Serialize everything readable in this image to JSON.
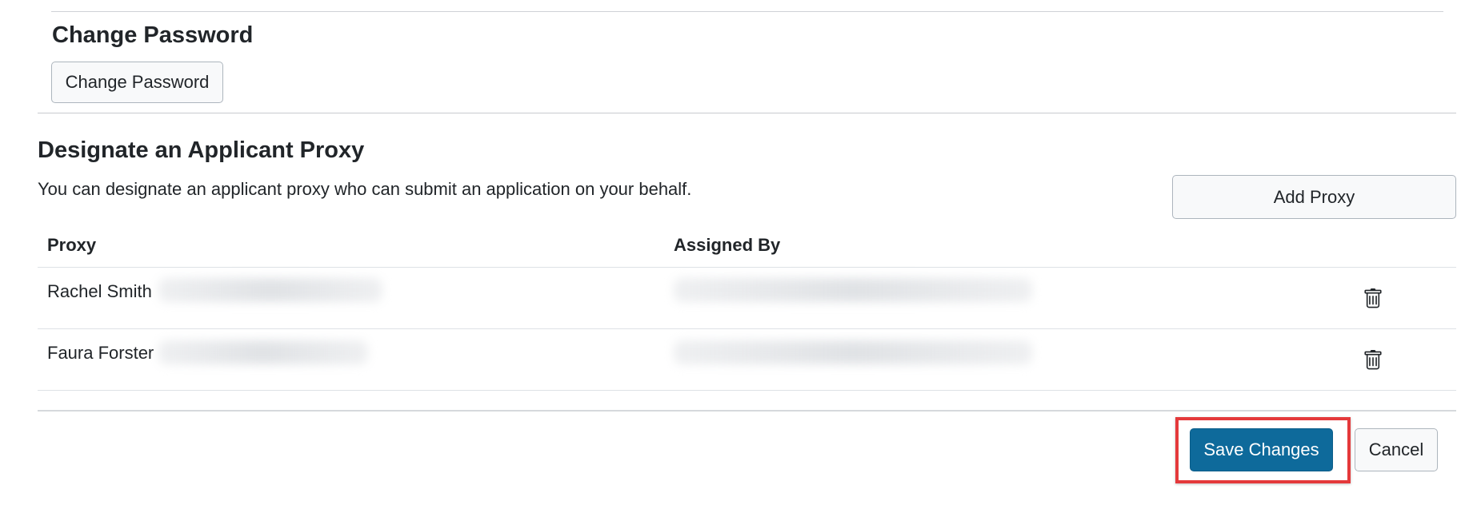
{
  "change_password": {
    "title": "Change Password",
    "button_label": "Change Password"
  },
  "proxy_section": {
    "title": "Designate an Applicant Proxy",
    "description": "You can designate an applicant proxy who can submit an application on your behalf.",
    "add_button_label": "Add Proxy",
    "table": {
      "columns": [
        "Proxy",
        "Assigned By"
      ],
      "rows": [
        {
          "name": "Rachel Smith"
        },
        {
          "name": "Faura Forster"
        }
      ]
    }
  },
  "footer": {
    "save_label": "Save Changes",
    "cancel_label": "Cancel"
  },
  "icons": {
    "delete": "trash-icon"
  },
  "colors": {
    "primary": "#0e6a9b",
    "highlight": "#e4393b",
    "secondary_bg": "#f8f9fa"
  }
}
